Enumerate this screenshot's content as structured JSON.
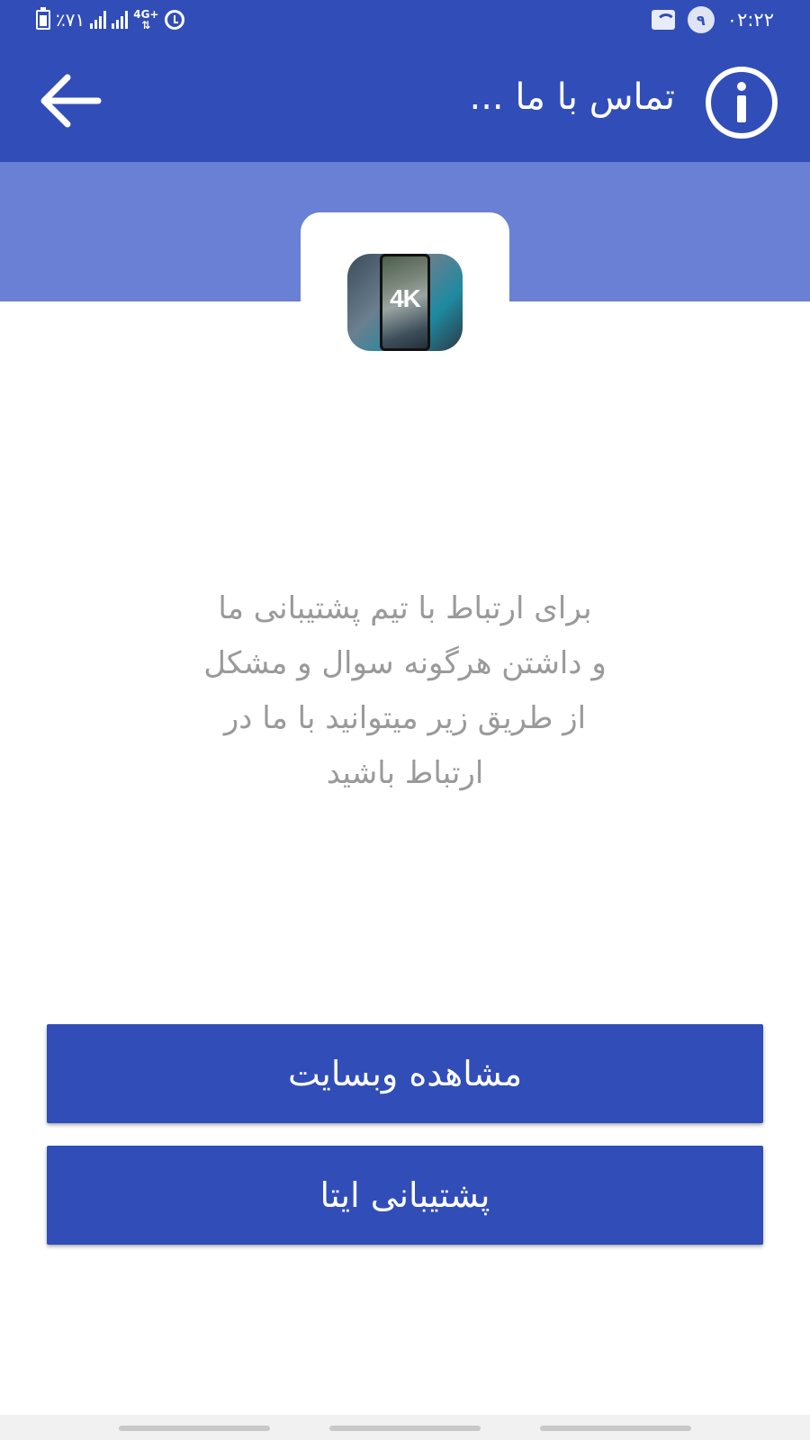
{
  "status_bar": {
    "battery_percent": "٪۷۱",
    "network_type": "4G+",
    "time": "۰۲:۲۲",
    "notification_count": "۹"
  },
  "app_bar": {
    "title": "تماس با ما ...",
    "back_icon": "arrow-left-icon",
    "info_icon": "info-circle-icon"
  },
  "header": {
    "app_icon_label": "4K"
  },
  "body": {
    "message_lines": [
      "برای ارتباط با تیم پشتیبانی ما",
      "و داشتن هرگونه سوال و مشکل",
      "از طریق زیر میتوانید با ما در",
      "ارتباط باشید"
    ]
  },
  "buttons": {
    "website": "مشاهده وبسایت",
    "eitaa_support": "پشتیبانی ایتا"
  },
  "colors": {
    "primary": "#314db8",
    "band": "#6a80d5",
    "message_text": "#9a9a9a"
  }
}
